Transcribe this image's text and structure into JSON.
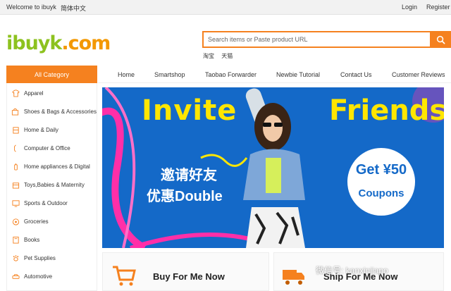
{
  "topbar": {
    "welcome": "Welcome to ibuyk",
    "language": "简体中文",
    "login": "Login",
    "register": "Register"
  },
  "logo": {
    "brand": "ibuyk.com"
  },
  "search": {
    "placeholder": "Search items or Paste product URL",
    "button_icon": "search-icon",
    "quick_links": [
      "淘宝",
      "天猫"
    ]
  },
  "all_category": "All Category",
  "nav": [
    "Home",
    "Smartshop",
    "Taobao Forwarder",
    "Newbie Tutorial",
    "Contact Us",
    "Customer Reviews"
  ],
  "categories": [
    {
      "label": "Apparel",
      "icon": "shirt-icon"
    },
    {
      "label": "Shoes & Bags & Accessories",
      "icon": "bag-icon"
    },
    {
      "label": "Home & Daily",
      "icon": "home-icon"
    },
    {
      "label": "Computer & Office",
      "icon": "mouse-icon"
    },
    {
      "label": "Home appliances & Digital",
      "icon": "appliance-icon"
    },
    {
      "label": "Toys,Babies & Maternity",
      "icon": "toy-icon"
    },
    {
      "label": "Sports & Outdoor",
      "icon": "monitor-icon"
    },
    {
      "label": "Groceries",
      "icon": "groceries-icon"
    },
    {
      "label": "Books",
      "icon": "book-icon"
    },
    {
      "label": "Pet Supplies",
      "icon": "pet-icon"
    },
    {
      "label": "Automotive",
      "icon": "car-icon"
    }
  ],
  "banner": {
    "headline_left": "Invite",
    "headline_right": "Friends",
    "cn_line1": "邀请好友",
    "cn_line2": "优惠Double",
    "coupon_amount": "Get ¥50",
    "coupon_label": "Coupons"
  },
  "cards": [
    {
      "title": "Buy For Me Now",
      "icon": "cart-icon"
    },
    {
      "title": "Ship For Me Now",
      "icon": "truck-icon"
    }
  ],
  "watermark": "微信号: kanxinjiapo",
  "colors": {
    "accent": "#f5811f",
    "brand_green": "#8dc21f",
    "banner_blue": "#1469c8",
    "banner_yellow": "#ffe600"
  }
}
